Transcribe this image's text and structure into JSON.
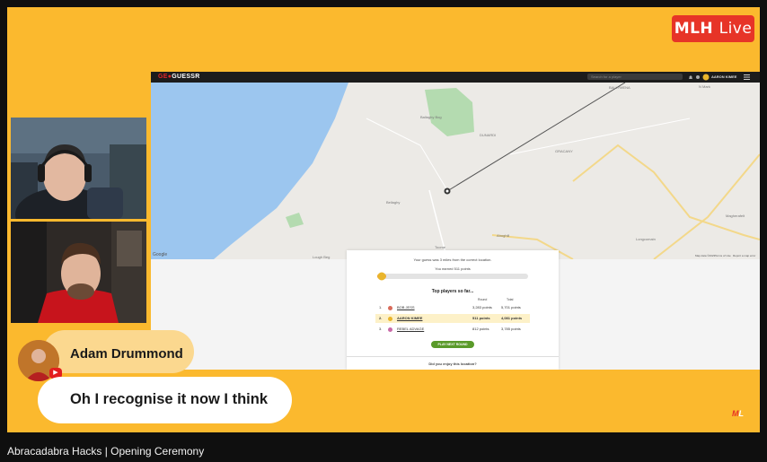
{
  "badge": {
    "brand": "MLH",
    "live": "Live"
  },
  "geoguessr": {
    "logo_prefix": "GE",
    "logo_suffix": "GUESSR",
    "search_placeholder": "Search for a player",
    "username": "AARON KIMEE",
    "map": {
      "labels": [
        "BALLYMENA",
        "N Mark",
        "DUNARDI",
        "GRACANY",
        "Bellaghy",
        "Ballaghy Bog",
        "Lough Beg",
        "Toome",
        "Ahoghill",
        "Longcomain",
        "Magherafelt",
        "Google"
      ],
      "footer": [
        "Map data ©2023",
        "Terms of Use",
        "Report a map error"
      ]
    },
    "result": {
      "guess_text": "Your guess was 3 miles from the correct location.",
      "points_text": "You earned 511 points",
      "top_players_title": "Top players so far...",
      "col_round": "Round",
      "col_total": "Total",
      "players": [
        {
          "rank": "1.",
          "name": "BOB JESS",
          "round": "3,283 points",
          "total": "5,701 points"
        },
        {
          "rank": "2.",
          "name": "AARON KIMEE",
          "round": "511 points",
          "total": "4,081 points"
        },
        {
          "rank": "3.",
          "name": "REBEL ADVAGE",
          "round": "812 points",
          "total": "3,785 points"
        }
      ],
      "play_next": "PLAY NEXT ROUND",
      "enjoy_text": "Did you enjoy this location?"
    }
  },
  "overlay": {
    "speaker_name": "Adam Drummond",
    "message": "Oh I recognise it now I think"
  },
  "corner_logo": {
    "m": "M",
    "l": "L"
  },
  "video_title": "Abracadabra Hacks | Opening Ceremony",
  "colors": {
    "stage": "#fbb92e",
    "badge": "#e73427",
    "pill": "#fbd88f"
  }
}
